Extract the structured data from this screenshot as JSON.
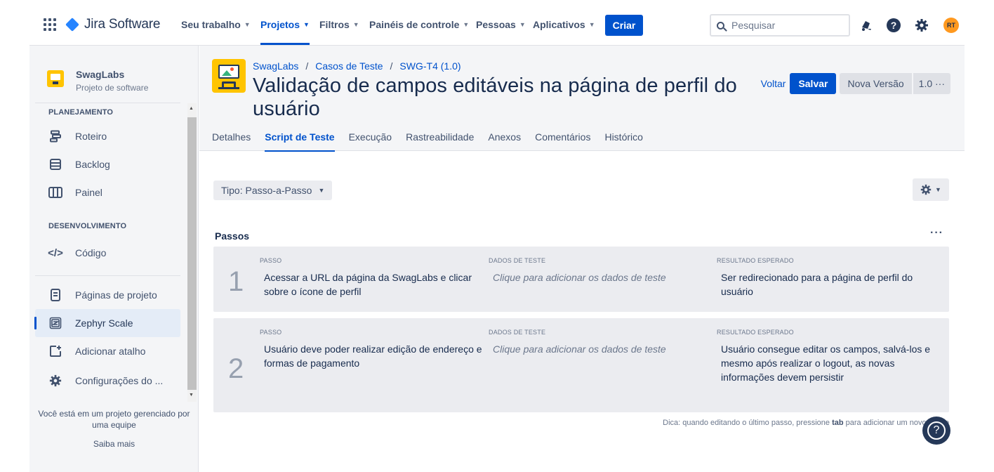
{
  "topnav": {
    "product": "Jira Software",
    "menu": [
      {
        "label": "Seu trabalho"
      },
      {
        "label": "Projetos"
      },
      {
        "label": "Filtros"
      },
      {
        "label": "Painéis de controle"
      },
      {
        "label": "Pessoas"
      },
      {
        "label": "Aplicativos"
      }
    ],
    "active_menu": "Projetos",
    "create_label": "Criar",
    "search_placeholder": "Pesquisar",
    "avatar_initials": "RT",
    "icons": [
      "apps-grid-icon",
      "jira-logo-icon",
      "notifications-icon",
      "help-icon",
      "settings-gear-icon"
    ]
  },
  "sidebar": {
    "project_name": "SwagLabs",
    "project_type": "Projeto de software",
    "section_planning": "PLANEJAMENTO",
    "planning_items": [
      {
        "label": "Roteiro",
        "icon": "roadmap-icon"
      },
      {
        "label": "Backlog",
        "icon": "backlog-icon"
      },
      {
        "label": "Painel",
        "icon": "board-icon"
      }
    ],
    "section_dev": "DESENVOLVIMENTO",
    "dev_items": [
      {
        "label": "Código",
        "icon": "code-icon"
      }
    ],
    "bottom_items": [
      {
        "label": "Páginas de projeto",
        "icon": "page-icon"
      },
      {
        "label": "Zephyr Scale",
        "icon": "zephyr-icon"
      },
      {
        "label": "Adicionar atalho",
        "icon": "add-shortcut-icon"
      },
      {
        "label": "Configurações do ...",
        "icon": "settings-gear-icon"
      }
    ],
    "selected_item": "Zephyr Scale",
    "footer_text": "Você está em um projeto gerenciado por uma equipe",
    "footer_link": "Saiba mais"
  },
  "breadcrumb": [
    "SwagLabs",
    "Casos de Teste",
    "SWG-T4 (1.0)"
  ],
  "page": {
    "title": "Validação de campos editáveis na página de perfil do usuário",
    "back_label": "Voltar",
    "save_label": "Salvar",
    "new_version_label": "Nova Versão",
    "version_label": "1.0 ···"
  },
  "tabs": [
    {
      "label": "Detalhes"
    },
    {
      "label": "Script de Teste"
    },
    {
      "label": "Execução"
    },
    {
      "label": "Rastreabilidade"
    },
    {
      "label": "Anexos"
    },
    {
      "label": "Comentários"
    },
    {
      "label": "Histórico"
    }
  ],
  "active_tab": "Script de Teste",
  "script": {
    "type_label": "Tipo: Passo-a-Passo",
    "section_title": "Passos",
    "more_label": "···",
    "col_step": "PASSO",
    "col_data": "DADOS DE TESTE",
    "col_result": "RESULTADO ESPERADO",
    "steps": [
      {
        "number": "1",
        "step": "Acessar a URL da página da SwagLabs e clicar sobre o ícone de perfil",
        "data": "Clique para adicionar os dados de teste",
        "result": "Ser redirecionado para a página de perfil do usuário"
      },
      {
        "number": "2",
        "step": "Usuário deve poder realizar edição de endereço e formas de pagamento",
        "data": "Clique para adicionar os dados de teste",
        "result": "Usuário consegue editar os campos, salvá-los e mesmo após realizar o logout, as novas informações devem persistir"
      }
    ],
    "hint_prefix": "Dica: quando editando o último passo, pressione ",
    "hint_key": "tab",
    "hint_suffix": " para adicionar um novo passo"
  },
  "colors": {
    "brand_blue": "#0052cc",
    "sidebar_bg": "#f4f5f7",
    "step_bg": "#ebecf0",
    "project_yellow": "#ffc400",
    "avatar_orange": "#ff991f"
  }
}
